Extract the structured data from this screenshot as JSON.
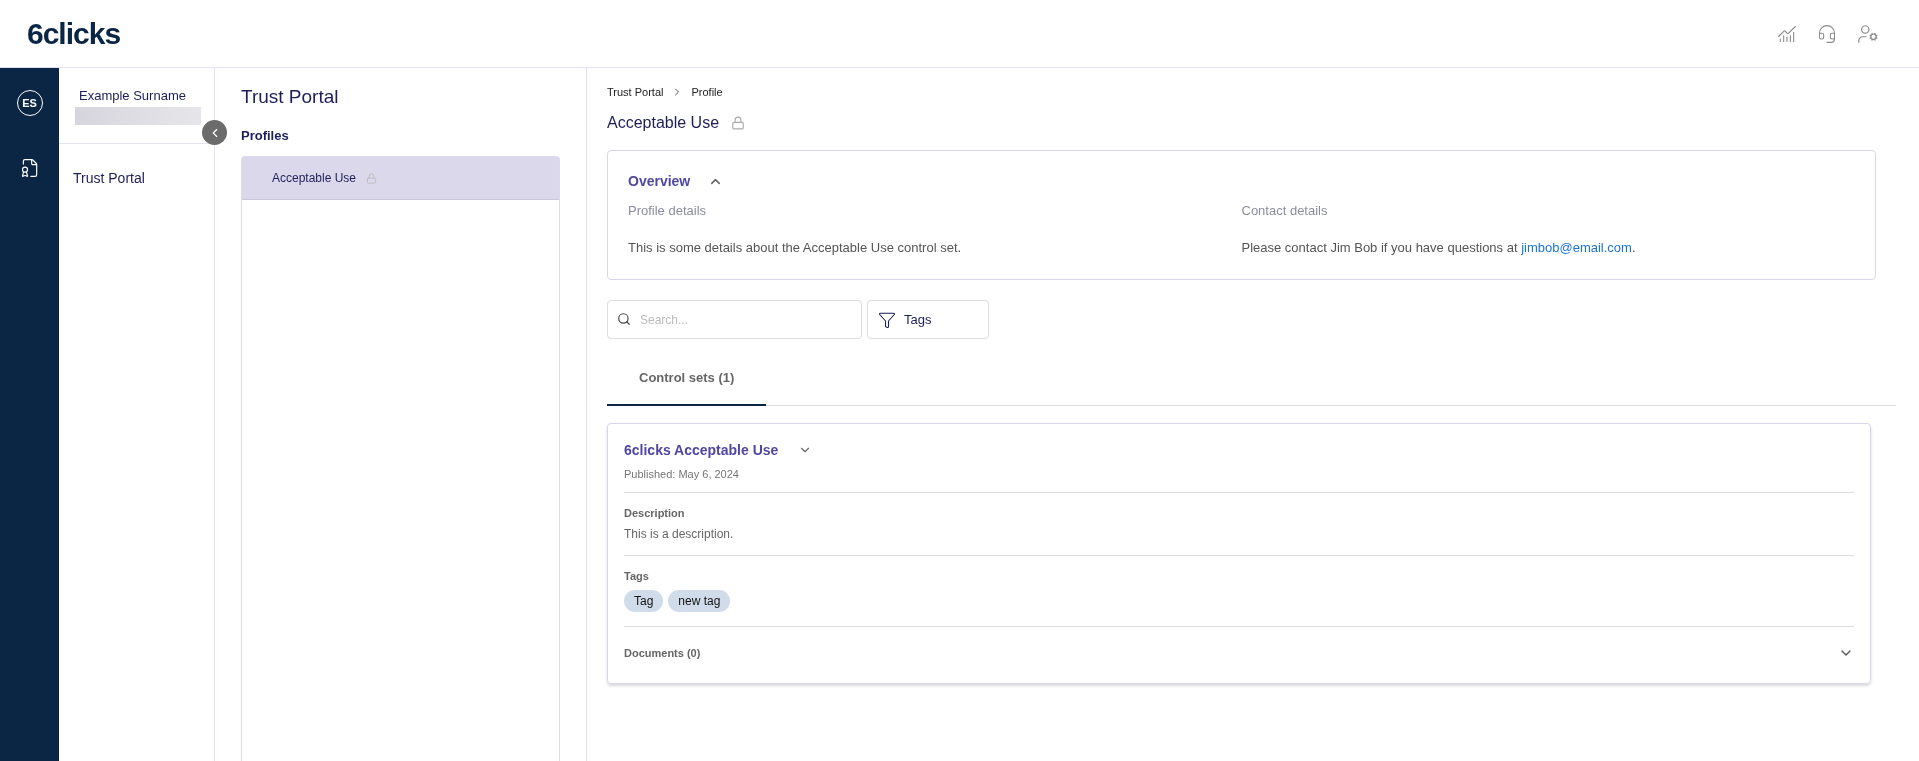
{
  "header": {
    "logo_mark": "6",
    "logo_text": "clicks"
  },
  "rail": {
    "avatar": "ES"
  },
  "user": {
    "name": "Example Surname"
  },
  "nav": {
    "items": [
      {
        "label": "Trust Portal"
      }
    ]
  },
  "profiles_panel": {
    "title": "Trust Portal",
    "subtitle": "Profiles",
    "items": [
      {
        "label": "Acceptable Use",
        "selected": true,
        "locked": true
      }
    ]
  },
  "breadcrumb": [
    "Trust Portal",
    "Profile"
  ],
  "page_title": {
    "text": "Acceptable Use",
    "locked": true
  },
  "overview": {
    "title": "Overview",
    "expanded": true,
    "sections": [
      {
        "heading": "Profile details",
        "text": "This is some details about the Acceptable Use control set."
      },
      {
        "heading": "Contact details",
        "text": "Please contact Jim Bob if you have questions at ",
        "link": "jimbob@email.com",
        "after": "."
      }
    ]
  },
  "search": {
    "placeholder": "Search..."
  },
  "filter_button": "Tags",
  "tabs": [
    {
      "label": "Control sets (1)",
      "selected": true
    }
  ],
  "control_set": {
    "title": "6clicks Acceptable Use",
    "expanded": true,
    "published": "Published: May 6, 2024",
    "description_label": "Description",
    "description": "This is a description.",
    "tags_label": "Tags",
    "tags": [
      "Tag",
      "new tag"
    ],
    "documents": {
      "label": "Documents (0)",
      "expanded": false
    }
  }
}
